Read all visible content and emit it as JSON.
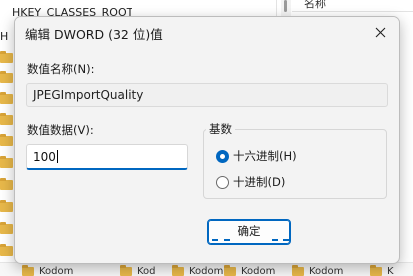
{
  "background": {
    "tree_rows": [
      "HKEY_CLASSES_ROOT",
      "H",
      "",
      "",
      "",
      "",
      "",
      "",
      "",
      "",
      "",
      "",
      "",
      "",
      ""
    ],
    "column_header": "名称",
    "bottom_items": [
      "Kodom",
      "Kod",
      "Kodom",
      "Kodom",
      "Kodom",
      "K"
    ]
  },
  "dialog": {
    "title": "编辑 DWORD (32 位)值",
    "close_icon": "close-icon",
    "value_name_label": "数值名称(N):",
    "value_name": "JPEGImportQuality",
    "value_data_label": "数值数据(V):",
    "value_data": "100",
    "base": {
      "title": "基数",
      "options": [
        {
          "label": "十六进制(H)",
          "checked": true
        },
        {
          "label": "十进制(D)",
          "checked": false
        }
      ]
    },
    "ok_label": "确定"
  },
  "colors": {
    "accent": "#0067c0",
    "dialog_bg": "#f3f3f3"
  }
}
